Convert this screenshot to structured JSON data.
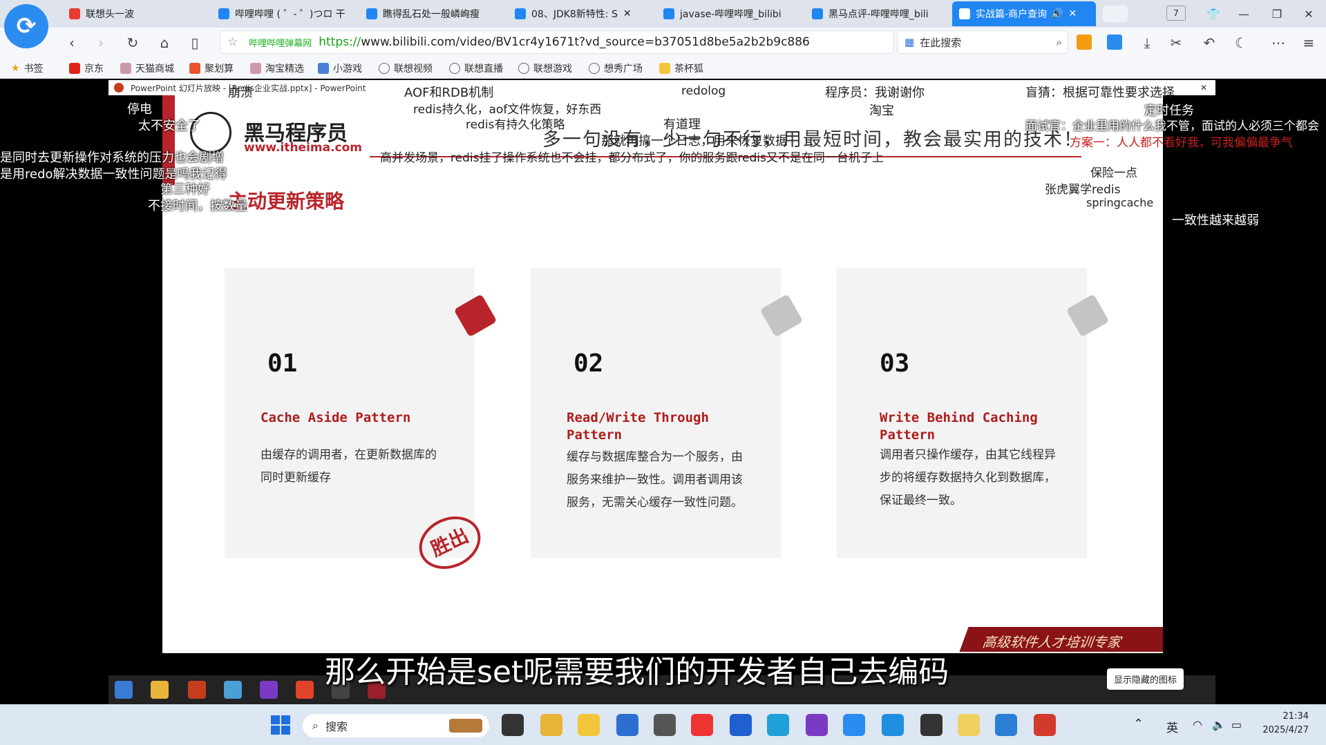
{
  "browser": {
    "tabs": [
      {
        "label": "联想头一波",
        "color": "#e83a2f"
      },
      {
        "label": "哔哩哔哩 ( ゜- ゜)つロ 干",
        "color": "#1f86f2"
      },
      {
        "label": "瞧得乱石处一般嶙峋瘦",
        "color": "#1f86f2"
      },
      {
        "label": "08、JDK8新特性: S",
        "color": "#1f86f2"
      },
      {
        "label": "javase-哔哩哔哩_bilibi",
        "color": "#1f86f2"
      },
      {
        "label": "黑马点评-哔哩哔哩_bili",
        "color": "#1f86f2"
      },
      {
        "label": "实战篇-商户查询",
        "color": "#ffffff"
      }
    ],
    "tab_count": "7",
    "address": {
      "site_label": "哔哩哔哩弹幕网",
      "url_scheme": "https://",
      "url_rest": "www.bilibili.com/video/BV1cr4y1671t?vd_source=b37051d8be5a2b2b9c886"
    },
    "search_placeholder": "在此搜索",
    "bookmarks": [
      "书签",
      "京东",
      "天猫商城",
      "聚划算",
      "淘宝精选",
      "小游戏",
      "联想视频",
      "联想直播",
      "联想游戏",
      "想秀广场",
      "茶杯狐"
    ]
  },
  "ppt": {
    "titlebar": "PowerPoint 幻灯片放映 - [Redis企业实战.pptx] - PowerPoint",
    "logo_text": "黑马程序员",
    "logo_url": "www.itheima.com",
    "slogan": "多一句没有，少一句不行，用最短时间，教会最实用的技术！",
    "section_title": "主动更新策略",
    "stamp": "胜出",
    "footer_brand": "高级软件人才培训专家",
    "cards": [
      {
        "num": "01",
        "title": "Cache Aside Pattern",
        "desc": "由缓存的调用者，在更新数据库的同时更新缓存",
        "tag_color": "#b8242b"
      },
      {
        "num": "02",
        "title": "Read/Write Through Pattern",
        "desc": "缓存与数据库整合为一个服务，由服务来维护一致性。调用者调用该服务，无需关心缓存一致性问题。",
        "tag_color": "#c4c4c4"
      },
      {
        "num": "03",
        "title": "Write Behind Caching Pattern",
        "desc": "调用者只操作缓存，由其它线程异步的将缓存数据持久化到数据库，保证最终一致。",
        "tag_color": "#c4c4c4"
      }
    ]
  },
  "danmaku": [
    "停电",
    "太不安全了",
    "崩溃",
    "AOF和RDB机制",
    "redis持久化，aof文件恢复，好东西",
    "redis有持久化策略",
    "redolog",
    "有道理",
    "那就再搞一个日志，用来恢复数据",
    "程序员：我谢谢你",
    "淘宝",
    "盲猜：根据可靠性要求选择",
    "定时任务",
    "面试官：企业里用的什么我不管，面试的人必须三个都会",
    "方案一：人人都不看好我，可我偏偏最争气",
    "是同时去更新操作对系统的压力也会剧增",
    "是用redo解决数据一致性问题是吗我记得",
    "第三种好",
    "不接时间，按数量",
    "高并发场景，redis挂了操作系统也不会挂，都分布式了，你的服务跟redis又不是在同一台机子上",
    "保险一点",
    "张虎翼学redis",
    "springcache",
    "一致性越来越弱"
  ],
  "subtitle": "那么开始是set呢需要我们的开发者自己去编码",
  "tooltip": "显示隐藏的图标",
  "taskbar": {
    "search_placeholder": "搜索",
    "ime": "英",
    "time": "21:34",
    "date": "2025/4/27"
  }
}
